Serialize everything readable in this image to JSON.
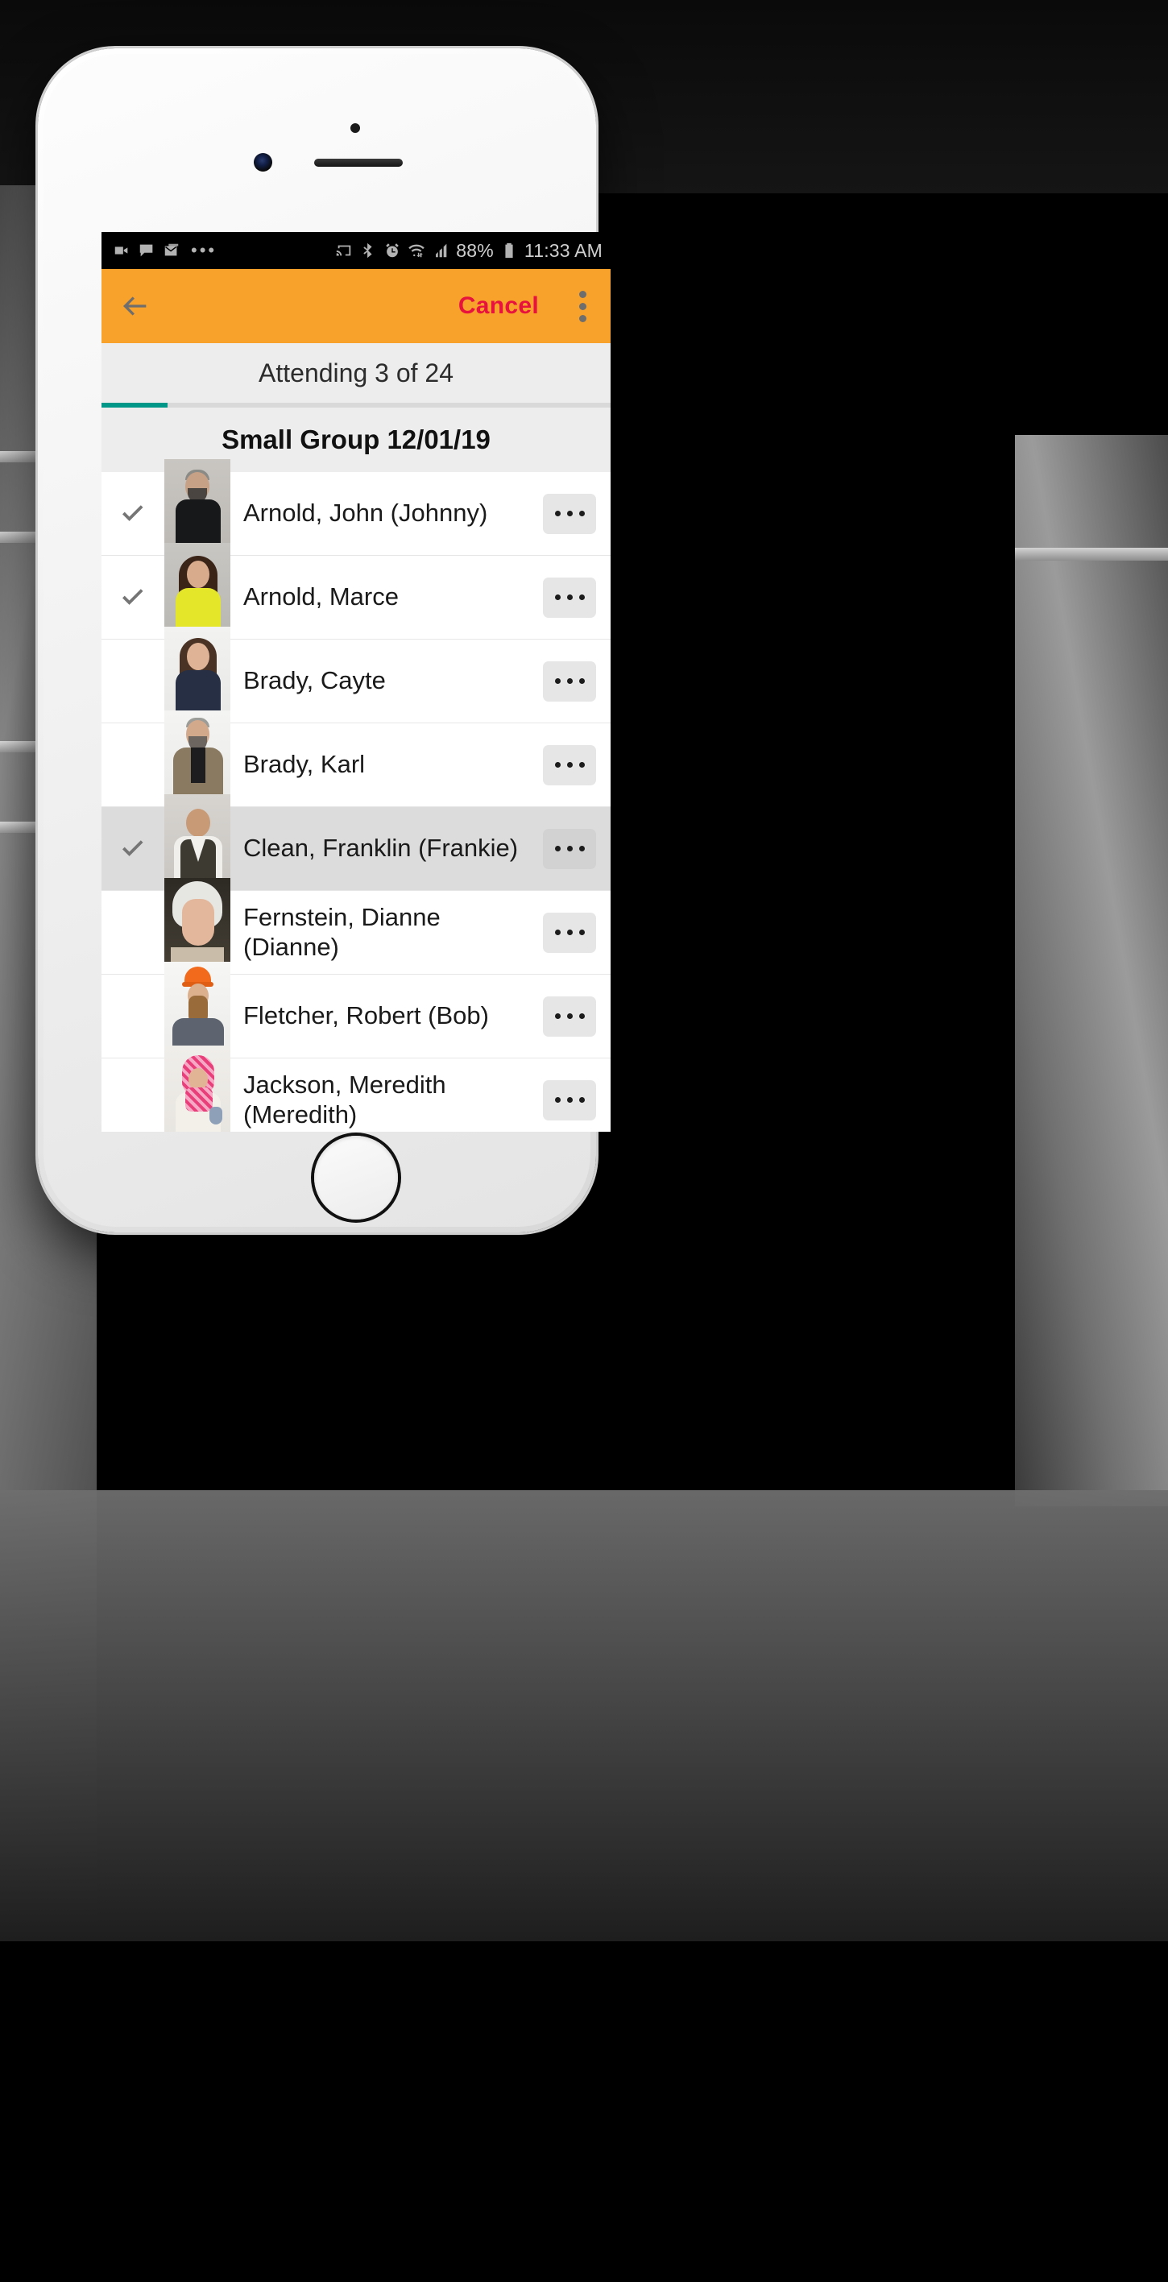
{
  "status_bar": {
    "left_icons": [
      "video-camera-icon",
      "chat-bubble-icon",
      "mail-icon",
      "overflow-dots-icon"
    ],
    "right_icons": [
      "cast-icon",
      "bluetooth-icon",
      "alarm-icon",
      "wifi-icon",
      "signal-icon",
      "battery-icon"
    ],
    "battery_percent": "88%",
    "time": "11:33 AM"
  },
  "app_bar": {
    "back_label": "back-arrow",
    "cancel_label": "Cancel",
    "overflow_label": "overflow-menu",
    "bg_color": "#F9A22B",
    "cancel_color": "#E8123E"
  },
  "header": {
    "attending_text": "Attending 3 of 24",
    "group_title": "Small Group 12/01/19",
    "progress_percent": 13,
    "progress_color": "#009688"
  },
  "list": {
    "more_button_label": "...",
    "rows": [
      {
        "name": "Arnold, John (Johnny)",
        "checked": true,
        "selected": false,
        "avatar": "av-john"
      },
      {
        "name": "Arnold, Marce",
        "checked": true,
        "selected": false,
        "avatar": "av-marce"
      },
      {
        "name": "Brady, Cayte",
        "checked": false,
        "selected": false,
        "avatar": "av-cayte"
      },
      {
        "name": "Brady, Karl",
        "checked": false,
        "selected": false,
        "avatar": "av-karl"
      },
      {
        "name": "Clean, Franklin (Frankie)",
        "checked": true,
        "selected": true,
        "avatar": "av-frank"
      },
      {
        "name": "Fernstein, Dianne (Dianne)",
        "checked": false,
        "selected": false,
        "avatar": "av-dianne"
      },
      {
        "name": "Fletcher, Robert (Bob)",
        "checked": false,
        "selected": false,
        "avatar": "av-bob"
      },
      {
        "name": "Jackson, Meredith (Meredith)",
        "checked": false,
        "selected": false,
        "avatar": "av-mere"
      }
    ]
  }
}
